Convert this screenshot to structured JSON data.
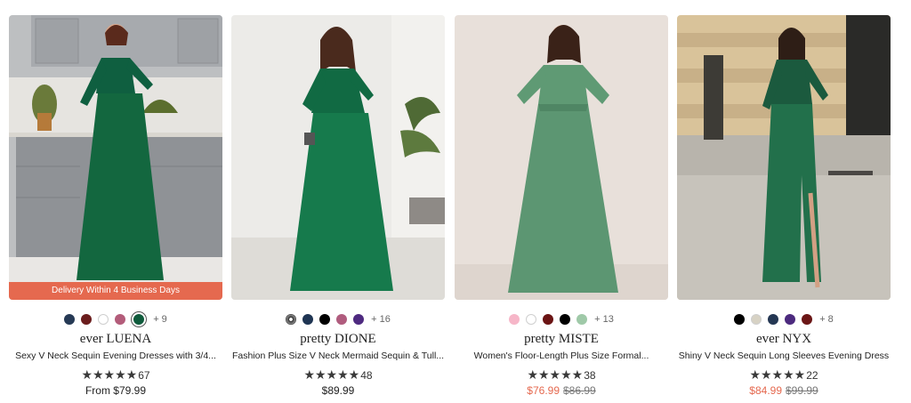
{
  "colors": {
    "sale": "#e5694f",
    "delivery_banner": "#e5694f"
  },
  "products": [
    {
      "image_alt": "woman in green sequin v-neck evening dress in kitchen",
      "delivery": "Delivery Within 4 Business Days",
      "swatches": [
        "#263a55",
        "#6b1d1d",
        "#ffffff",
        "#b35c7a",
        "#0f5b3c"
      ],
      "selected_swatch": 4,
      "more_colors": "+ 9",
      "collection": "ever LUENA",
      "title": "Sexy V Neck Sequin Evening Dresses with 3/4...",
      "stars": "★★★★★",
      "review_count": "67",
      "price": "From $79.99"
    },
    {
      "image_alt": "woman in green plus size mermaid sequin tulle dress",
      "swatches": [
        "pattern-leaf",
        "#1f3553",
        "#000000",
        "#b05c7e",
        "#4e2a80"
      ],
      "more_colors": "+ 16",
      "collection": "pretty DIONE",
      "title": "Fashion Plus Size V Neck Mermaid Sequin & Tull...",
      "stars": "★★★★★",
      "review_count": "48",
      "price": "$89.99"
    },
    {
      "image_alt": "woman in sage green floor-length chiffon dress",
      "swatches": [
        "#f6b6c8",
        "#ffffff",
        "#6b1414",
        "#000000",
        "#9fc9a8"
      ],
      "more_colors": "+ 13",
      "collection": "pretty MISTE",
      "title": "Women's Floor-Length Plus Size Formal...",
      "stars": "★★★★★",
      "review_count": "38",
      "sale_price": "$76.99",
      "original_price": "$86.99"
    },
    {
      "image_alt": "woman in shiny green sequin long sleeve evening dress outdoors",
      "swatches": [
        "#000000",
        "#d7d2c4",
        "#243753",
        "#4c2a7e",
        "#6b1616"
      ],
      "more_colors": "+ 8",
      "collection": "ever NYX",
      "title": "Shiny V Neck Sequin Long Sleeves Evening Dress",
      "stars": "★★★★★",
      "review_count": "22",
      "sale_price": "$84.99",
      "original_price": "$99.99"
    }
  ]
}
